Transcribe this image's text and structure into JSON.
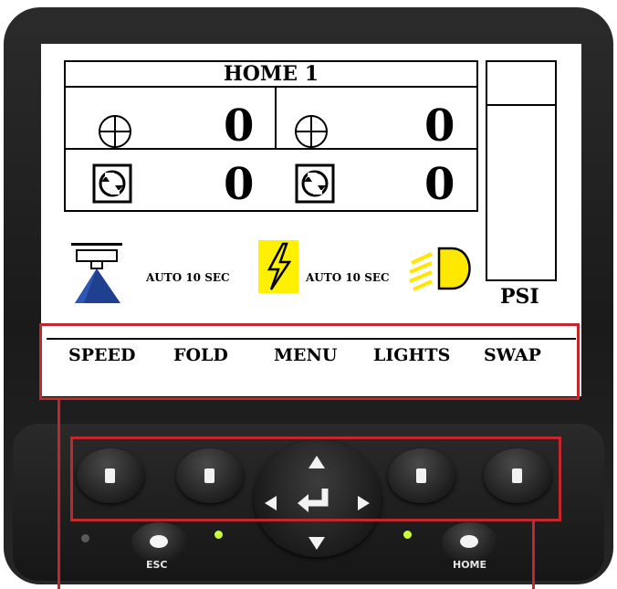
{
  "display": {
    "title": "HOME 1",
    "cells": [
      {
        "icon": "crosshair-circle-icon",
        "value": "0"
      },
      {
        "icon": "crosshair-circle-icon",
        "value": "0"
      },
      {
        "icon": "rotation-square-icon",
        "value": "0"
      },
      {
        "icon": "rotation-square-icon",
        "value": "0"
      }
    ],
    "pressure_unit": "PSI",
    "status": [
      {
        "icon": "spray-nozzle-icon",
        "label": "AUTO 10 SEC"
      },
      {
        "icon": "lightning-icon",
        "label": "AUTO 10 SEC"
      },
      {
        "icon": "headlight-icon"
      }
    ]
  },
  "softkeys": [
    "SPEED",
    "FOLD",
    "MENU",
    "LIGHTS",
    "SWAP"
  ],
  "buttons": {
    "esc_label": "ESC",
    "home_label": "HOME"
  },
  "colors": {
    "highlight_red": "#c1272d",
    "nozzle_blue": "#1f3f8f",
    "lightning_yellow": "#ffef00",
    "headlight_yellow": "#ffe800",
    "led_green": "#c8ff3a"
  }
}
